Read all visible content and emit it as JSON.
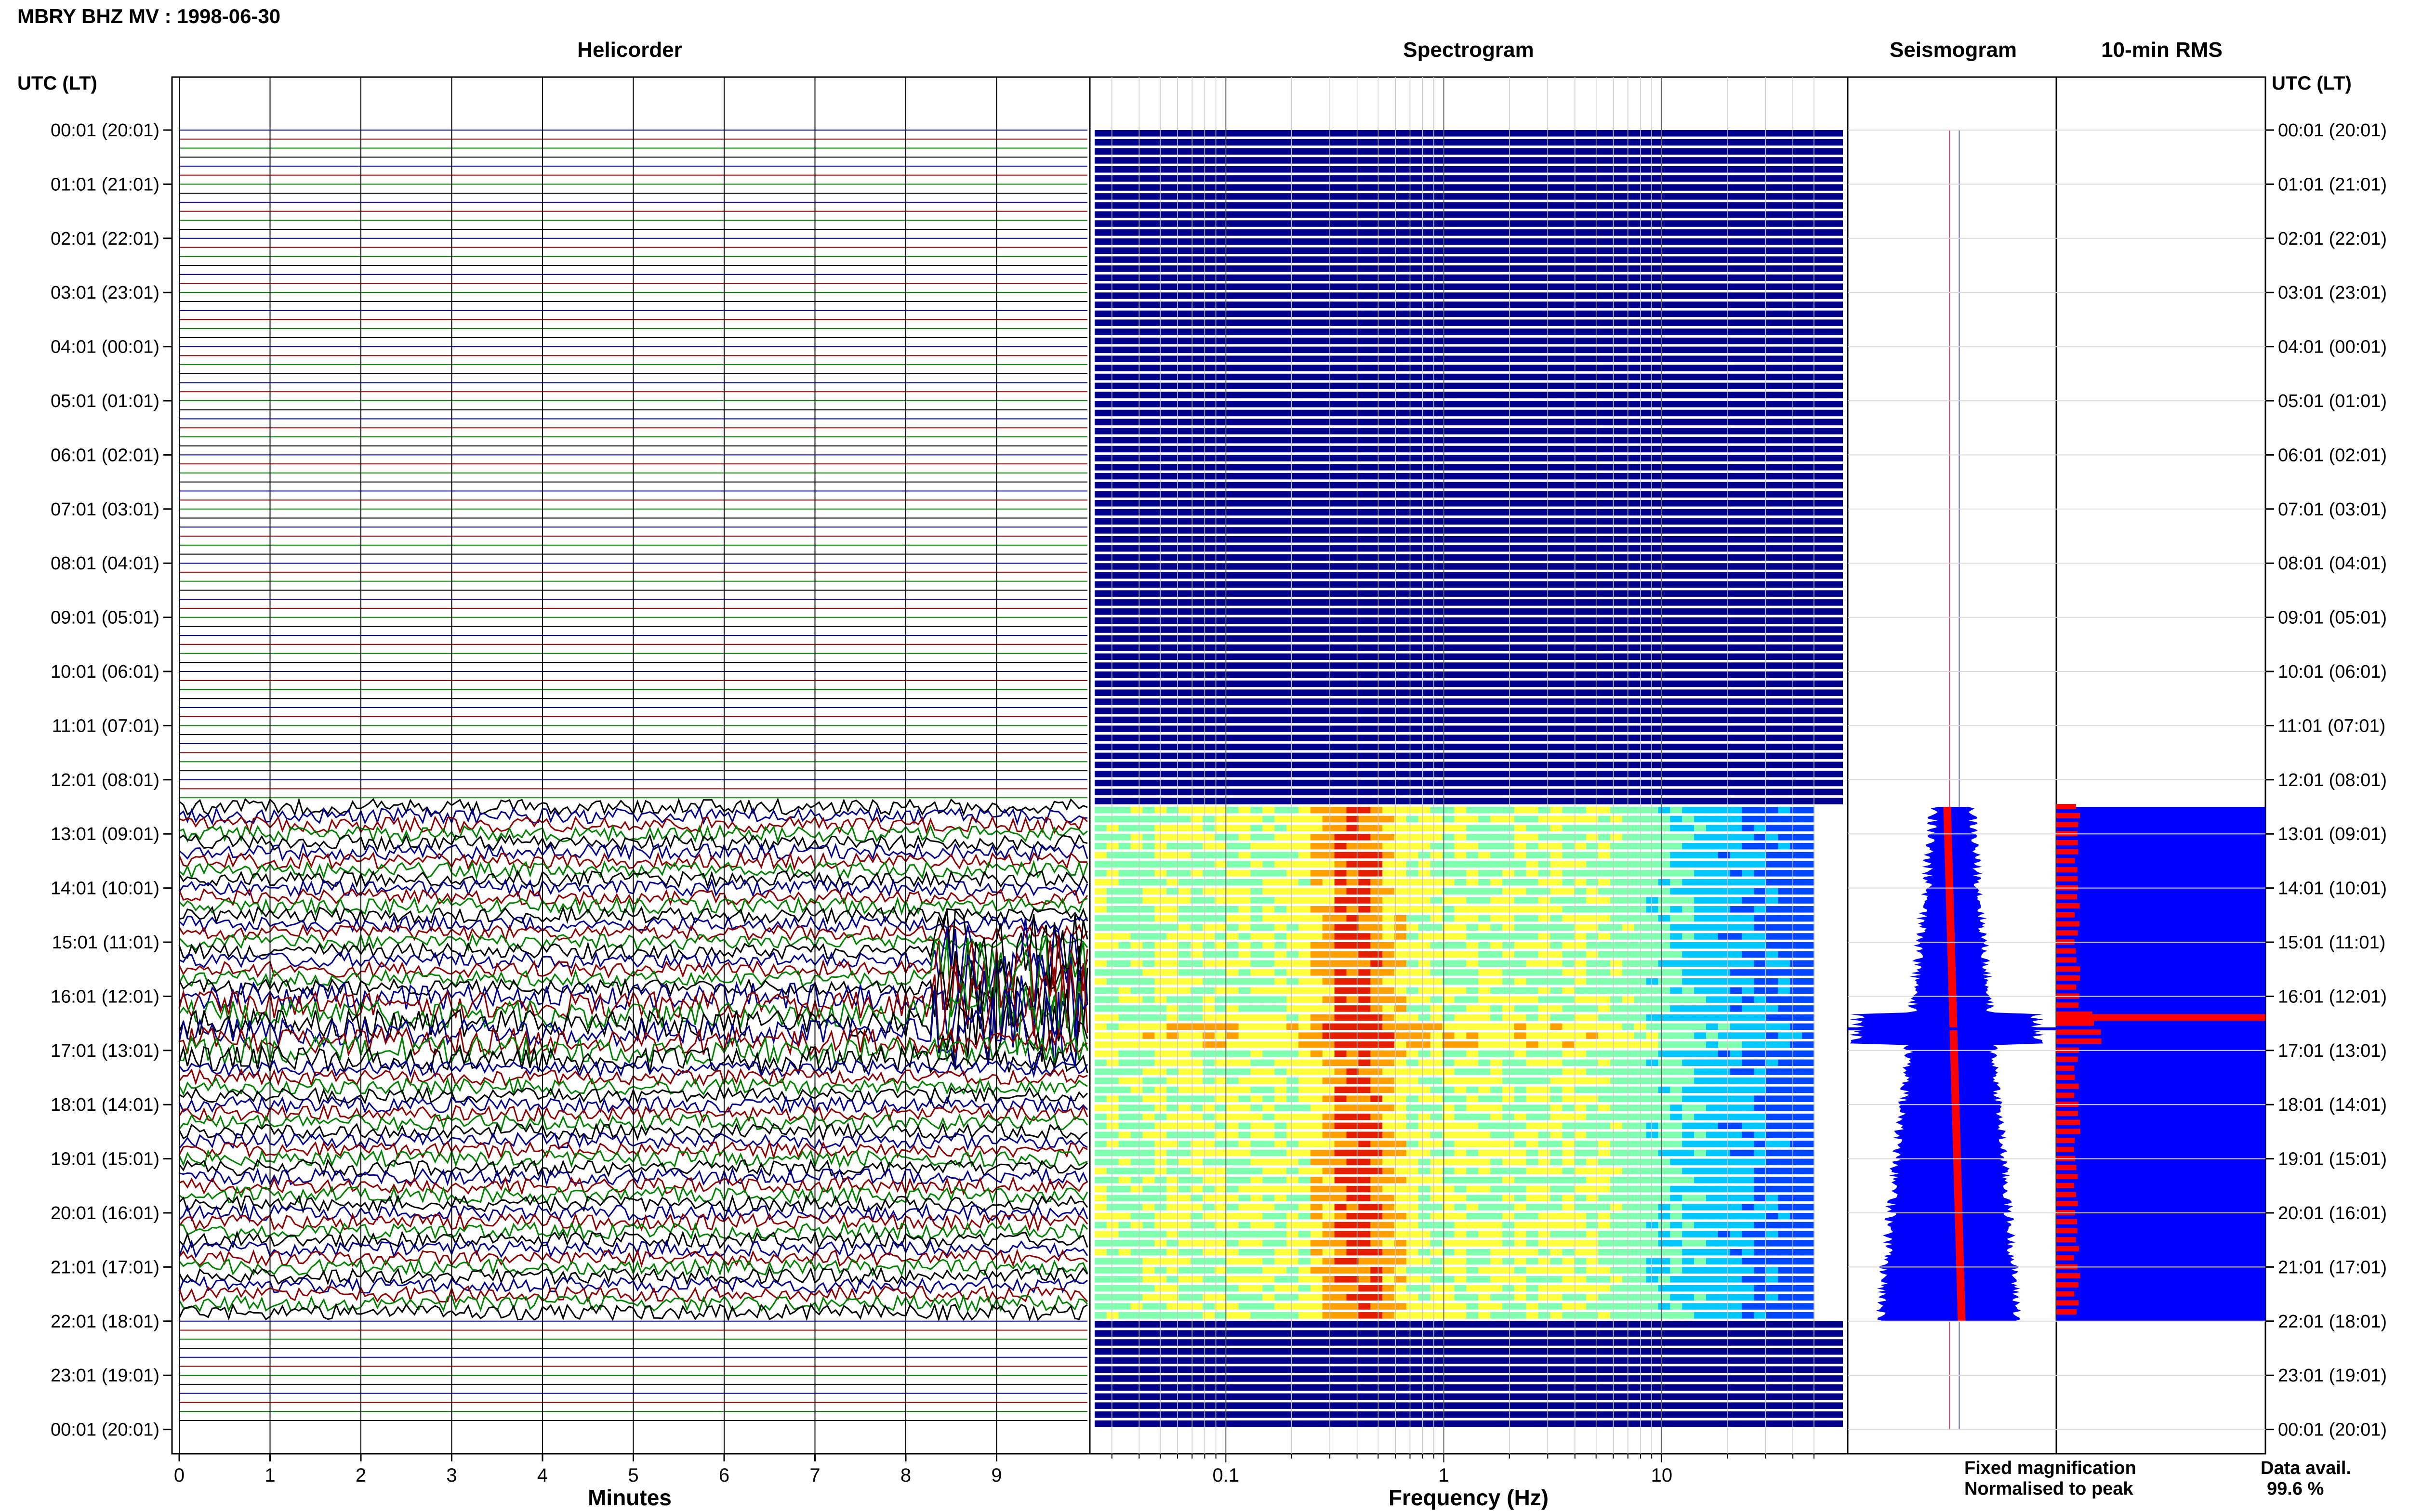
{
  "header": {
    "title": "MBRY BHZ MV : 1998-06-30"
  },
  "panels": {
    "helicorder": "Helicorder",
    "spectrogram": "Spectrogram",
    "seismogram": "Seismogram",
    "rms": "10-min RMS"
  },
  "axis_labels": {
    "time_left": "UTC (LT)",
    "time_right": "UTC (LT)",
    "minutes": "Minutes",
    "frequency": "Frequency (Hz)"
  },
  "legend": {
    "fixed": "Fixed magnification",
    "normalised": "Normalised to peak",
    "fixed_color": "#0000ff",
    "normalised_color": "#ff0000"
  },
  "data_avail": {
    "label": "Data avail.",
    "value": "99.6 %"
  },
  "chart_data": {
    "type": "heatmap",
    "time_ticks": [
      "00:01 (20:01)",
      "01:01 (21:01)",
      "02:01 (22:01)",
      "03:01 (23:01)",
      "04:01 (00:01)",
      "05:01 (01:01)",
      "06:01 (02:01)",
      "07:01 (03:01)",
      "08:01 (04:01)",
      "09:01 (05:01)",
      "10:01 (06:01)",
      "11:01 (07:01)",
      "12:01 (08:01)",
      "13:01 (09:01)",
      "14:01 (10:01)",
      "15:01 (11:01)",
      "16:01 (12:01)",
      "17:01 (13:01)",
      "18:01 (14:01)",
      "19:01 (15:01)",
      "20:01 (16:01)",
      "21:01 (17:01)",
      "22:01 (18:01)",
      "23:01 (19:01)",
      "00:01 (20:01)"
    ],
    "minute_ticks": [
      "0",
      "1",
      "2",
      "3",
      "4",
      "5",
      "6",
      "7",
      "8",
      "9"
    ],
    "minute_range": [
      0,
      10
    ],
    "frequency_ticks": [
      {
        "value": 0.1,
        "label": "0.1"
      },
      {
        "value": 1,
        "label": "1"
      },
      {
        "value": 10,
        "label": "10"
      }
    ],
    "frequency_range_hz": [
      0.025,
      50
    ],
    "frequency_scale": "log",
    "data_start_hour": 12.5,
    "data_end_hour": 22.0,
    "event_hour": 16.6,
    "rms_peak_hour": 16.4,
    "trace_colors": [
      "#00008b",
      "#8b0000",
      "#008000",
      "#000000"
    ],
    "spectrogram_fill_color": "#00008b"
  }
}
